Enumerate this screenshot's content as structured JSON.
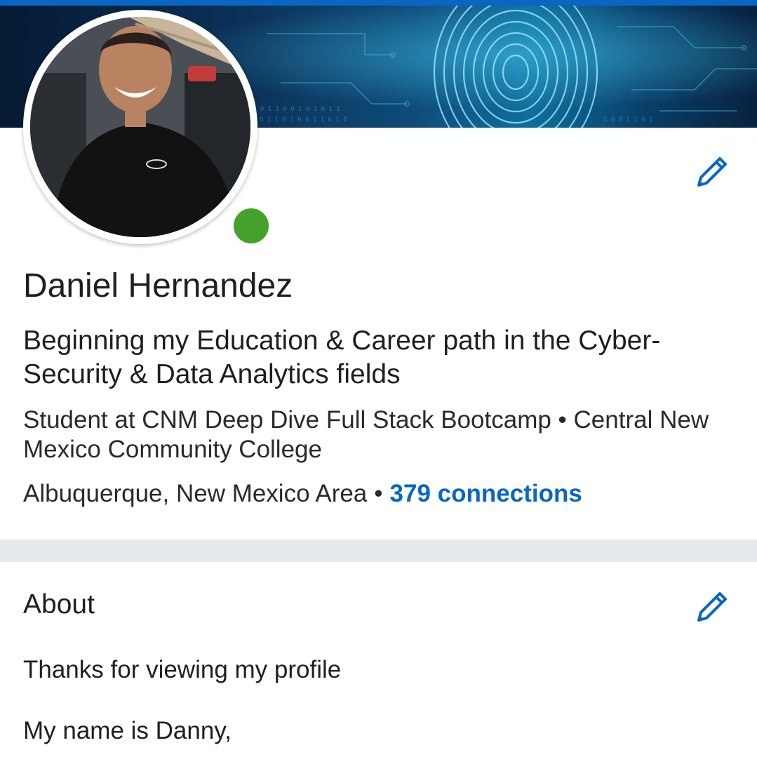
{
  "profile": {
    "name": "Daniel Hernandez",
    "headline": "Beginning my Education & Career path in the Cyber-Security & Data Analytics fields",
    "education_line": "Student at CNM Deep Dive Full Stack Bootcamp • Central New Mexico Community College",
    "location": "Albuquerque, New Mexico Area",
    "separator": "•",
    "connections": "379 connections",
    "online_status": "online"
  },
  "about": {
    "title": "About",
    "lines": [
      "Thanks for viewing my profile",
      "My name is Danny,"
    ]
  },
  "colors": {
    "accent": "#0a66c2",
    "presence": "#44a12b",
    "divider": "#e6e9ec"
  },
  "icons": {
    "edit": "pencil-icon",
    "banner": "fingerprint-circuit-image"
  }
}
